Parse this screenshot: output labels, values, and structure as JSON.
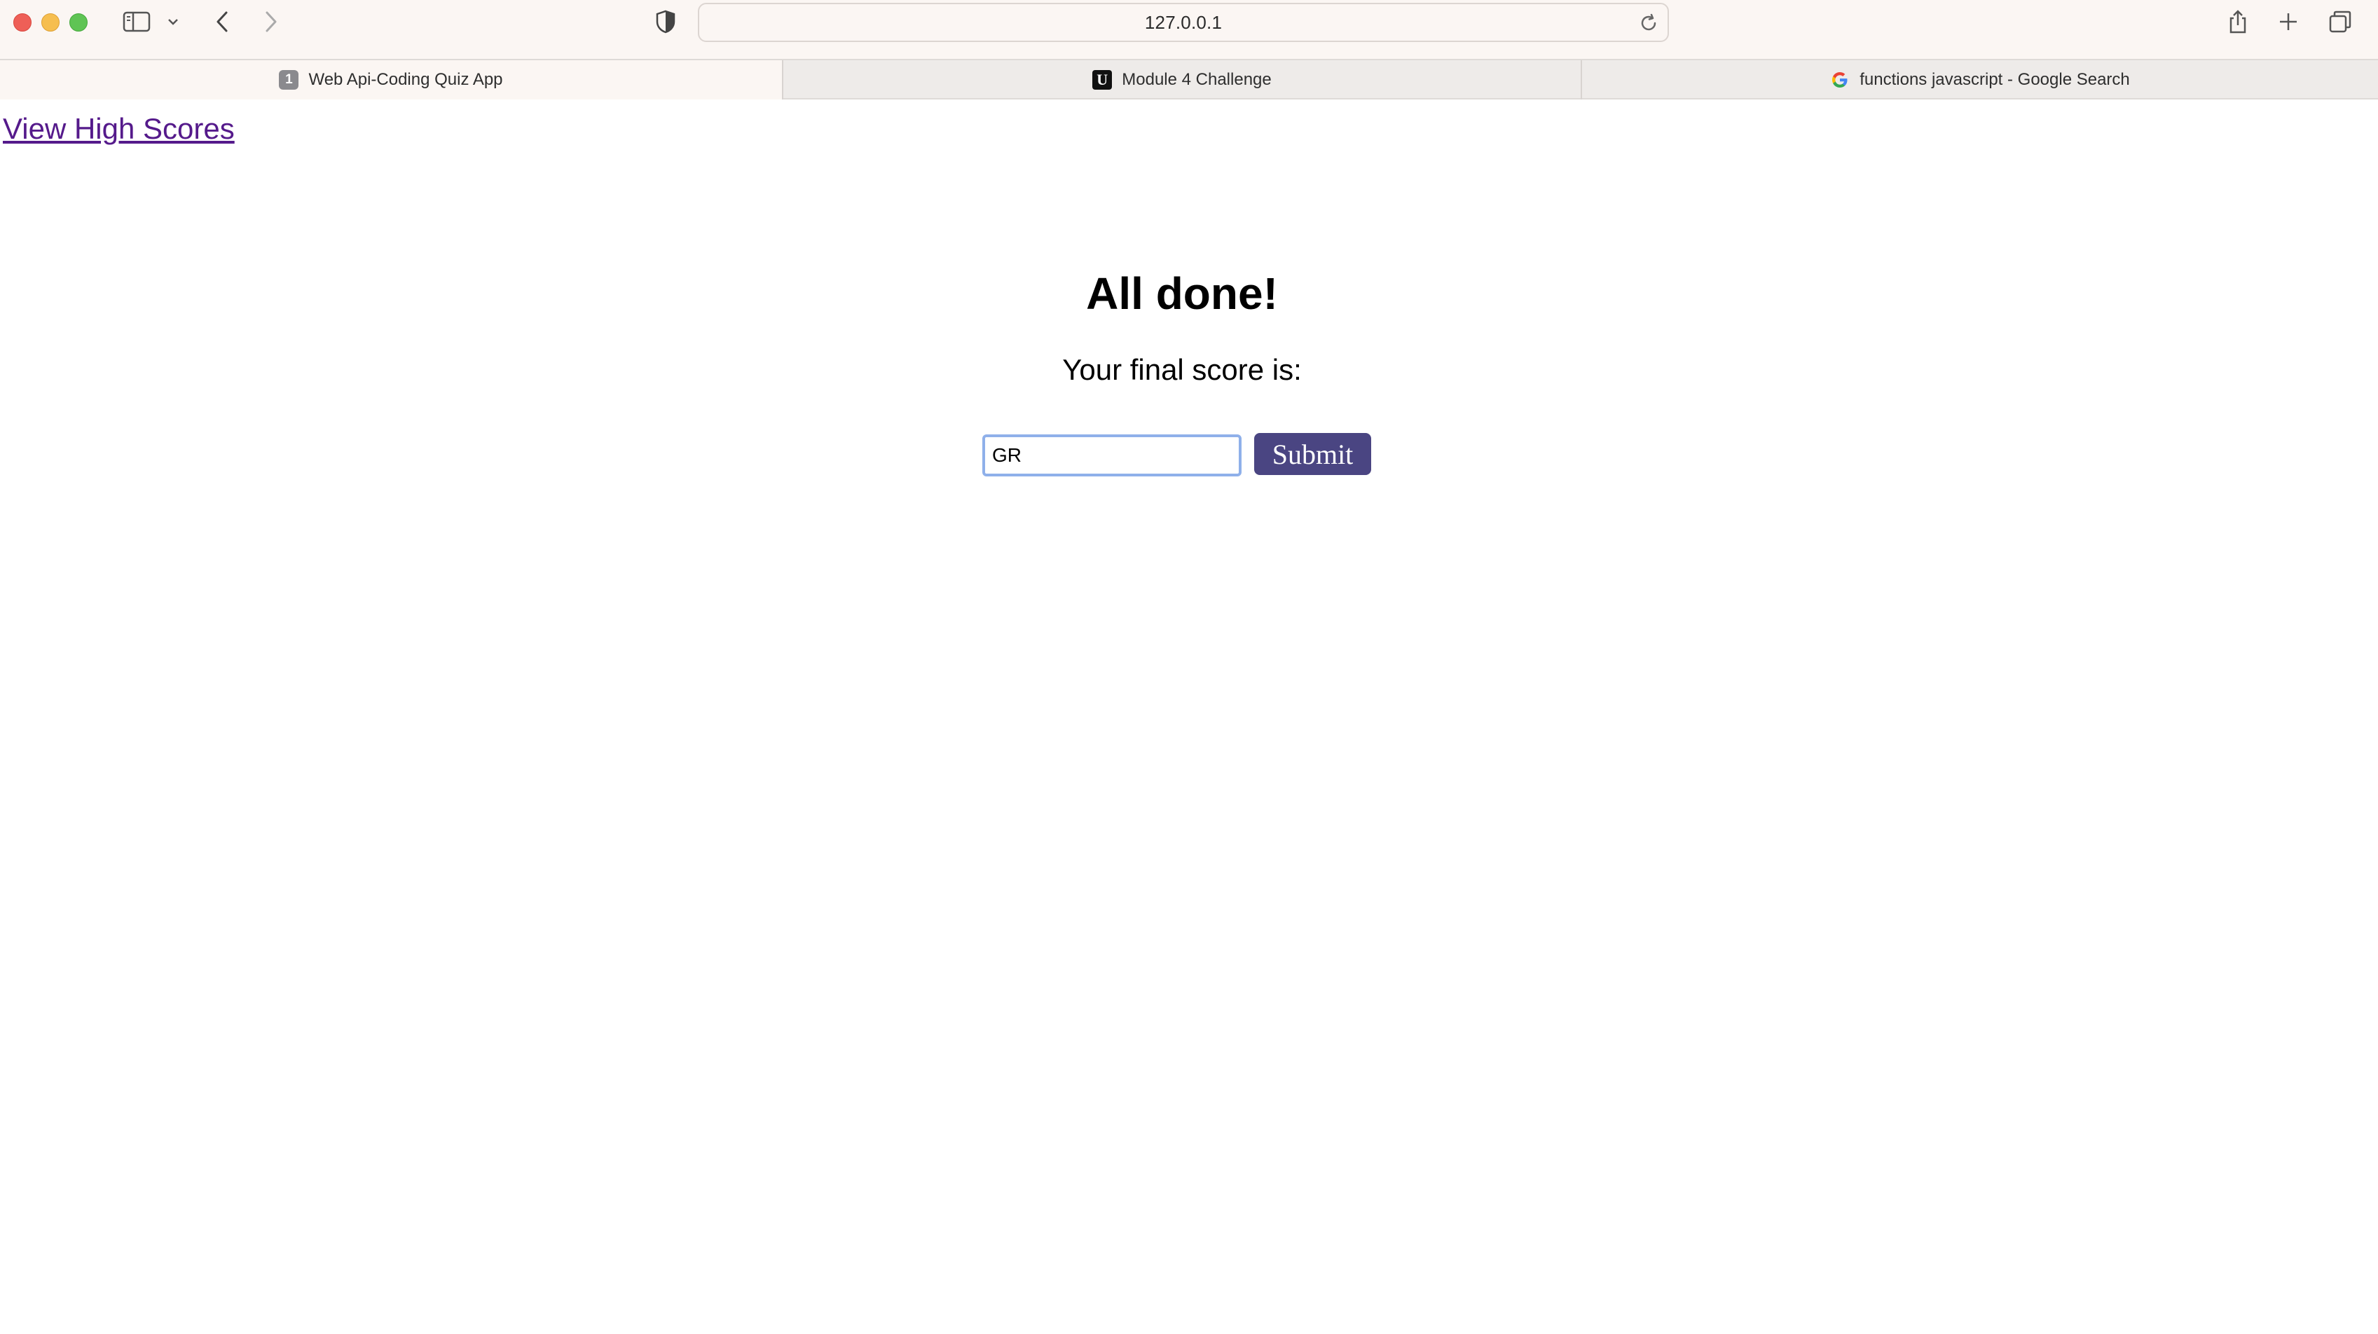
{
  "browser": {
    "url": "127.0.0.1",
    "tabs": [
      {
        "label": "Web Api-Coding Quiz App",
        "favicon": "1",
        "active": true
      },
      {
        "label": "Module 4 Challenge",
        "favicon": "U",
        "active": false
      },
      {
        "label": "functions javascript - Google Search",
        "favicon": "google-icon",
        "active": false
      }
    ]
  },
  "page": {
    "high_scores_link": "View High Scores",
    "title": "All done!",
    "score_text": "Your final score is:",
    "initials_value": "GR",
    "submit_label": "Submit"
  },
  "colors": {
    "link": "#551a8b",
    "submit_bg": "#4a4582",
    "input_focus": "#8fb0ea"
  }
}
